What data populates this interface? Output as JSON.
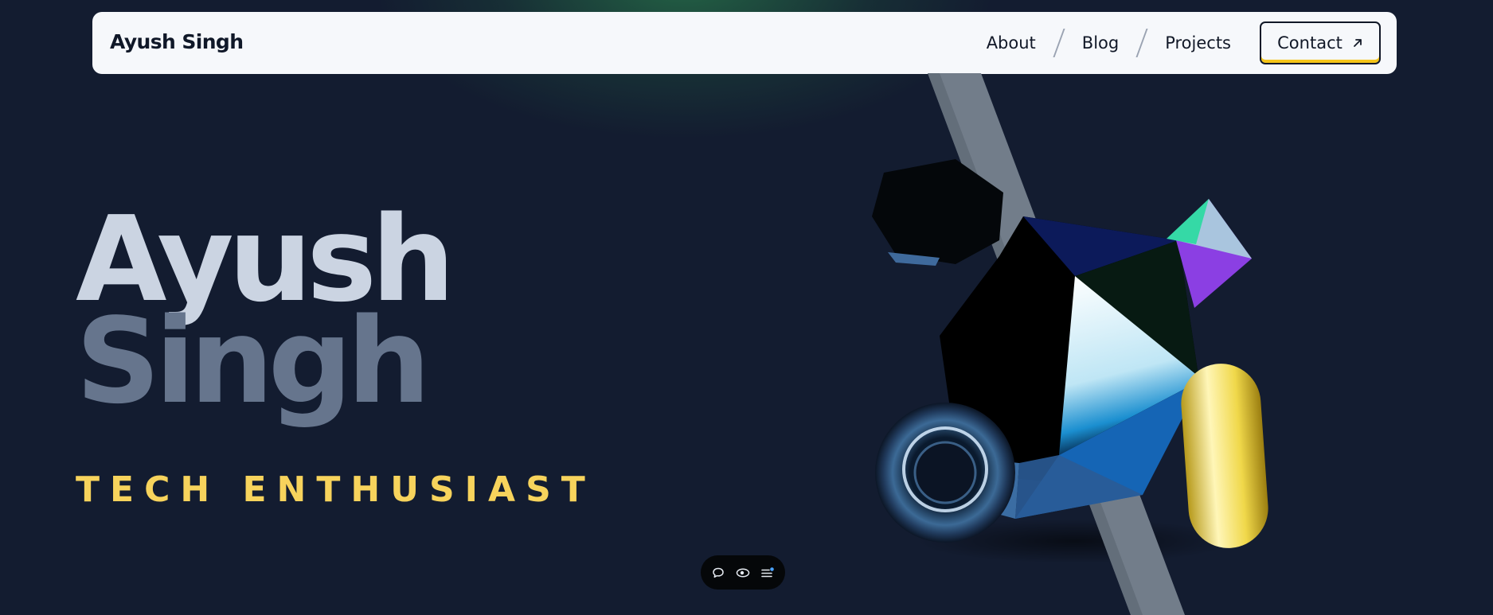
{
  "navbar": {
    "brand": "Ayush Singh",
    "links": [
      {
        "label": "About"
      },
      {
        "label": "Blog"
      },
      {
        "label": "Projects"
      }
    ],
    "contact_label": "Contact",
    "contact_icon": "arrow-up-right-icon"
  },
  "hero": {
    "first_name": "Ayush",
    "last_name": "Singh",
    "subtitle": "TECH ENTHUSIAST"
  },
  "dock": {
    "icons": [
      "chat-icon",
      "eye-icon",
      "menu-icon"
    ]
  },
  "colors": {
    "background": "#131c30",
    "glow": "#266e48",
    "navbar_bg": "#f6f8fb",
    "accent_yellow": "#f7d35c",
    "title_light": "#cbd4e2",
    "title_dim": "#66758d"
  }
}
